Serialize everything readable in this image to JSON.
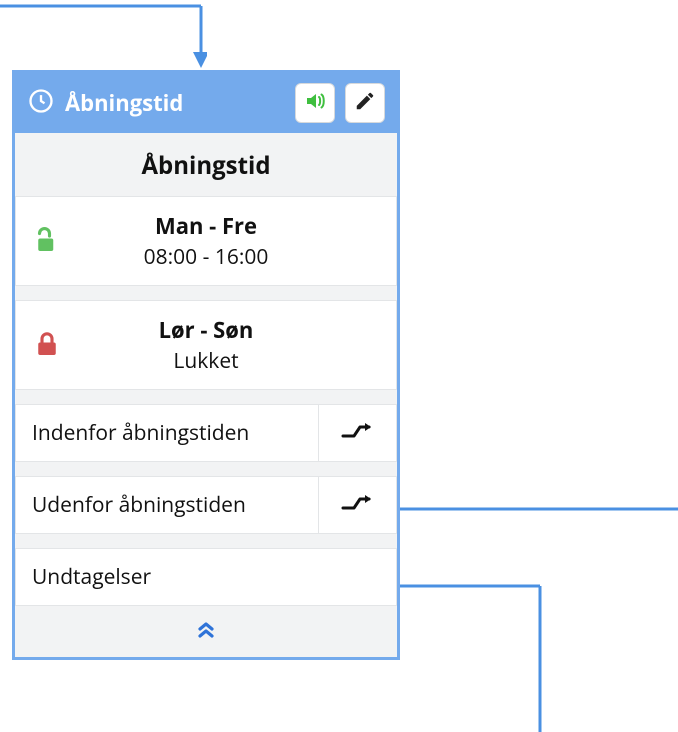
{
  "colors": {
    "accent": "#74aaec",
    "connector": "#4a90e2",
    "open": "#61c161",
    "closed": "#d15151",
    "sound": "#3fbf3f",
    "edit": "#222222"
  },
  "header": {
    "title": "Åbningstid"
  },
  "section_title": "Åbningstid",
  "slots": [
    {
      "days": "Man - Fre",
      "hours": "08:00 - 16:00",
      "state": "open"
    },
    {
      "days": "Lør - Søn",
      "hours": "Lukket",
      "state": "closed"
    }
  ],
  "rows": {
    "inside": "Indenfor åbningstiden",
    "outside": "Udenfor åbningstiden",
    "exceptions": "Undtagelser"
  }
}
